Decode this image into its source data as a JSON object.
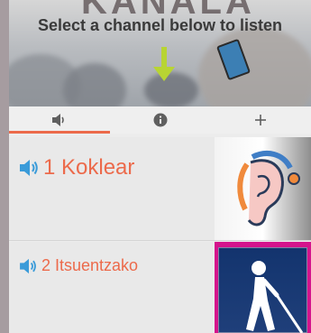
{
  "hero": {
    "brand_text": "KANALA",
    "title": "Select a channel below to listen"
  },
  "tabs": [
    {
      "name": "audio",
      "icon": "speaker-icon",
      "active": true
    },
    {
      "name": "info",
      "icon": "info-icon",
      "active": false
    },
    {
      "name": "add",
      "icon": "plus-icon",
      "active": false
    }
  ],
  "channels": [
    {
      "label": "1 Koklear",
      "icon": "speaker-icon",
      "image": "cochlear-implant-ear-image"
    },
    {
      "label": "2 Itsuentzako",
      "icon": "speaker-icon",
      "image": "blind-person-cane-image"
    }
  ],
  "colors": {
    "accent": "#ec6a4b",
    "arrow": "#b8d433",
    "thumb2_border": "#d4148c",
    "thumb2_bg": "#13346e"
  }
}
